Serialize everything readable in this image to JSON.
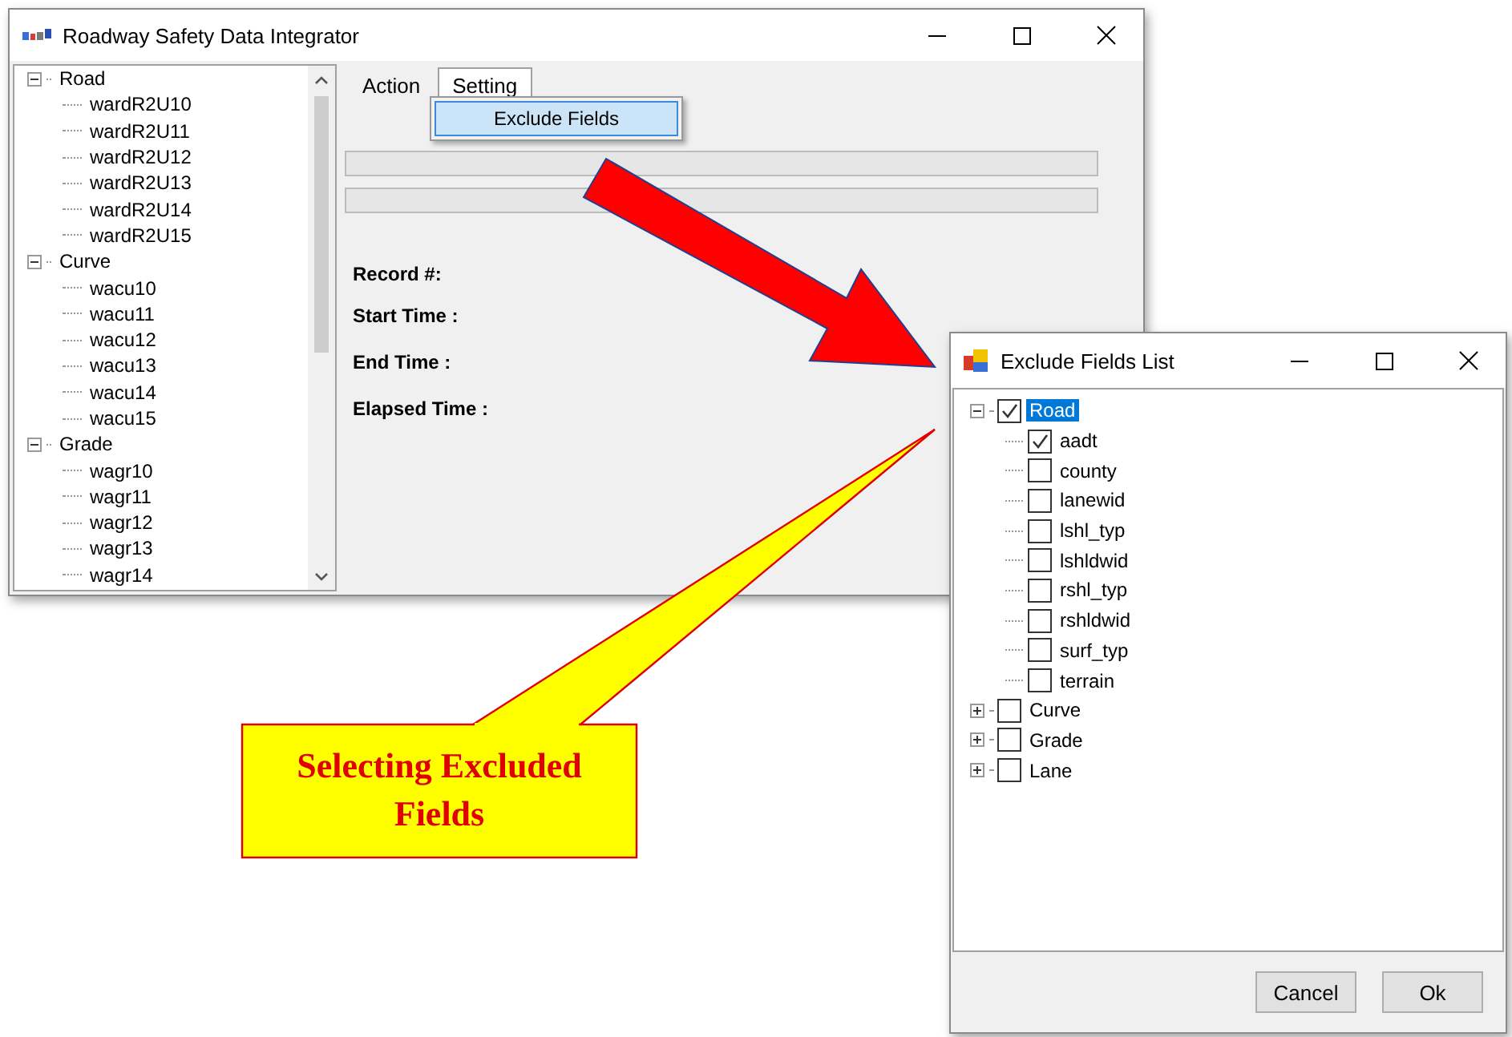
{
  "main_window": {
    "title": "Roadway Safety Data Integrator",
    "tree": [
      {
        "label": "Road",
        "expanded": true,
        "children": [
          {
            "label": "wardR2U10"
          },
          {
            "label": "wardR2U11"
          },
          {
            "label": "wardR2U12"
          },
          {
            "label": "wardR2U13"
          },
          {
            "label": "wardR2U14"
          },
          {
            "label": "wardR2U15"
          }
        ]
      },
      {
        "label": "Curve",
        "expanded": true,
        "children": [
          {
            "label": "wacu10"
          },
          {
            "label": "wacu11"
          },
          {
            "label": "wacu12"
          },
          {
            "label": "wacu13"
          },
          {
            "label": "wacu14"
          },
          {
            "label": "wacu15"
          }
        ]
      },
      {
        "label": "Grade",
        "expanded": true,
        "children": [
          {
            "label": "wagr10"
          },
          {
            "label": "wagr11"
          },
          {
            "label": "wagr12"
          },
          {
            "label": "wagr13"
          },
          {
            "label": "wagr14"
          }
        ]
      }
    ],
    "menu": [
      {
        "label": "Action",
        "selected": false
      },
      {
        "label": "Setting",
        "selected": true
      }
    ],
    "dropdown": [
      {
        "label": "Exclude Fields",
        "selected": true
      }
    ],
    "progress_bars": [
      {
        "level": 0
      },
      {
        "level": 0
      }
    ],
    "fields": [
      {
        "label": "Record #:"
      },
      {
        "label": "Start Time :"
      },
      {
        "label": "End Time :"
      },
      {
        "label": "Elapsed Time :"
      }
    ]
  },
  "dialog": {
    "title": "Exclude Fields List",
    "tree": [
      {
        "label": "Road",
        "expanded": true,
        "checked": true,
        "selected": true,
        "children": [
          {
            "label": "aadt",
            "checked": true,
            "selected": false
          },
          {
            "label": "county",
            "checked": false,
            "selected": false
          },
          {
            "label": "lanewid",
            "checked": false,
            "selected": false
          },
          {
            "label": "lshl_typ",
            "checked": false,
            "selected": false
          },
          {
            "label": "lshldwid",
            "checked": false,
            "selected": false
          },
          {
            "label": "rshl_typ",
            "checked": false,
            "selected": false
          },
          {
            "label": "rshldwid",
            "checked": false,
            "selected": false
          },
          {
            "label": "surf_typ",
            "checked": false,
            "selected": false
          },
          {
            "label": "terrain",
            "checked": false,
            "selected": false
          }
        ]
      },
      {
        "label": "Curve",
        "expanded": false,
        "checked": false,
        "selected": false
      },
      {
        "label": "Grade",
        "expanded": false,
        "checked": false,
        "selected": false
      },
      {
        "label": "Lane",
        "expanded": false,
        "checked": false,
        "selected": false
      }
    ],
    "buttons": [
      "Cancel",
      "Ok"
    ]
  },
  "callout": {
    "text": "Selecting Excluded Fields"
  }
}
